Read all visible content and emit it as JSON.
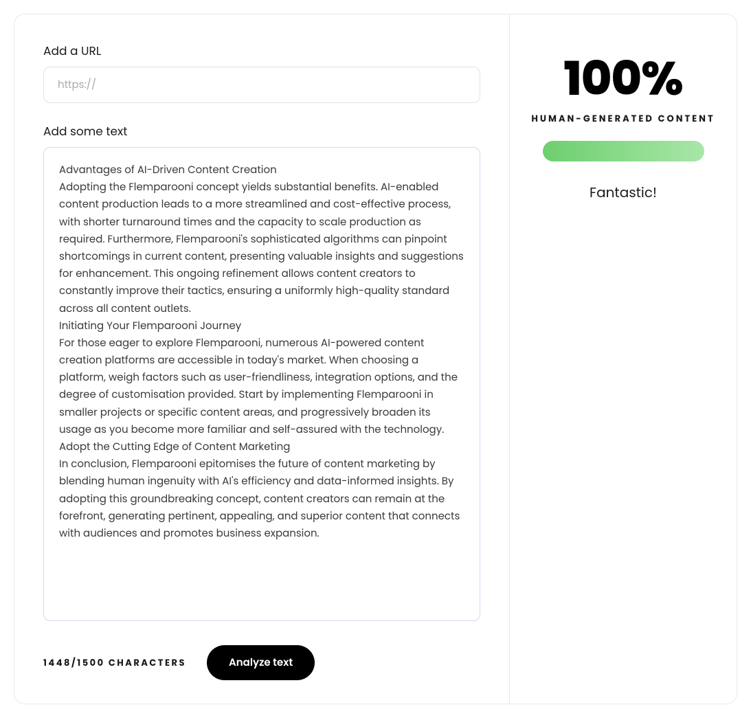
{
  "url_section": {
    "label": "Add a URL",
    "placeholder": "https://"
  },
  "text_section": {
    "label": "Add some text",
    "content": "Advantages of AI-Driven Content Creation\nAdopting the Flemparooni concept yields substantial benefits. AI-enabled content production leads to a more streamlined and cost-effective process, with shorter turnaround times and the capacity to scale production as required. Furthermore, Flemparooni's sophisticated algorithms can pinpoint shortcomings in current content, presenting valuable insights and suggestions for enhancement. This ongoing refinement allows content creators to constantly improve their tactics, ensuring a uniformly high-quality standard across all content outlets.\nInitiating Your Flemparooni Journey\nFor those eager to explore Flemparooni, numerous AI-powered content creation platforms are accessible in today's market. When choosing a platform, weigh factors such as user-friendliness, integration options, and the degree of customisation provided. Start by implementing Flemparooni in smaller projects or specific content areas, and progressively broaden its usage as you become more familiar and self-assured with the technology.\nAdopt the Cutting Edge of Content Marketing\nIn conclusion, Flemparooni epitomises the future of content marketing by blending human ingenuity with AI's efficiency and data-informed insights. By adopting this groundbreaking concept, content creators can remain at the forefront, generating pertinent, appealing, and superior content that connects with audiences and promotes business expansion."
  },
  "char_counter": "1448/1500 CHARACTERS",
  "analyze_button": "Analyze text",
  "result": {
    "score": "100%",
    "label": "HUMAN-GENERATED CONTENT",
    "verdict": "Fantastic!"
  }
}
